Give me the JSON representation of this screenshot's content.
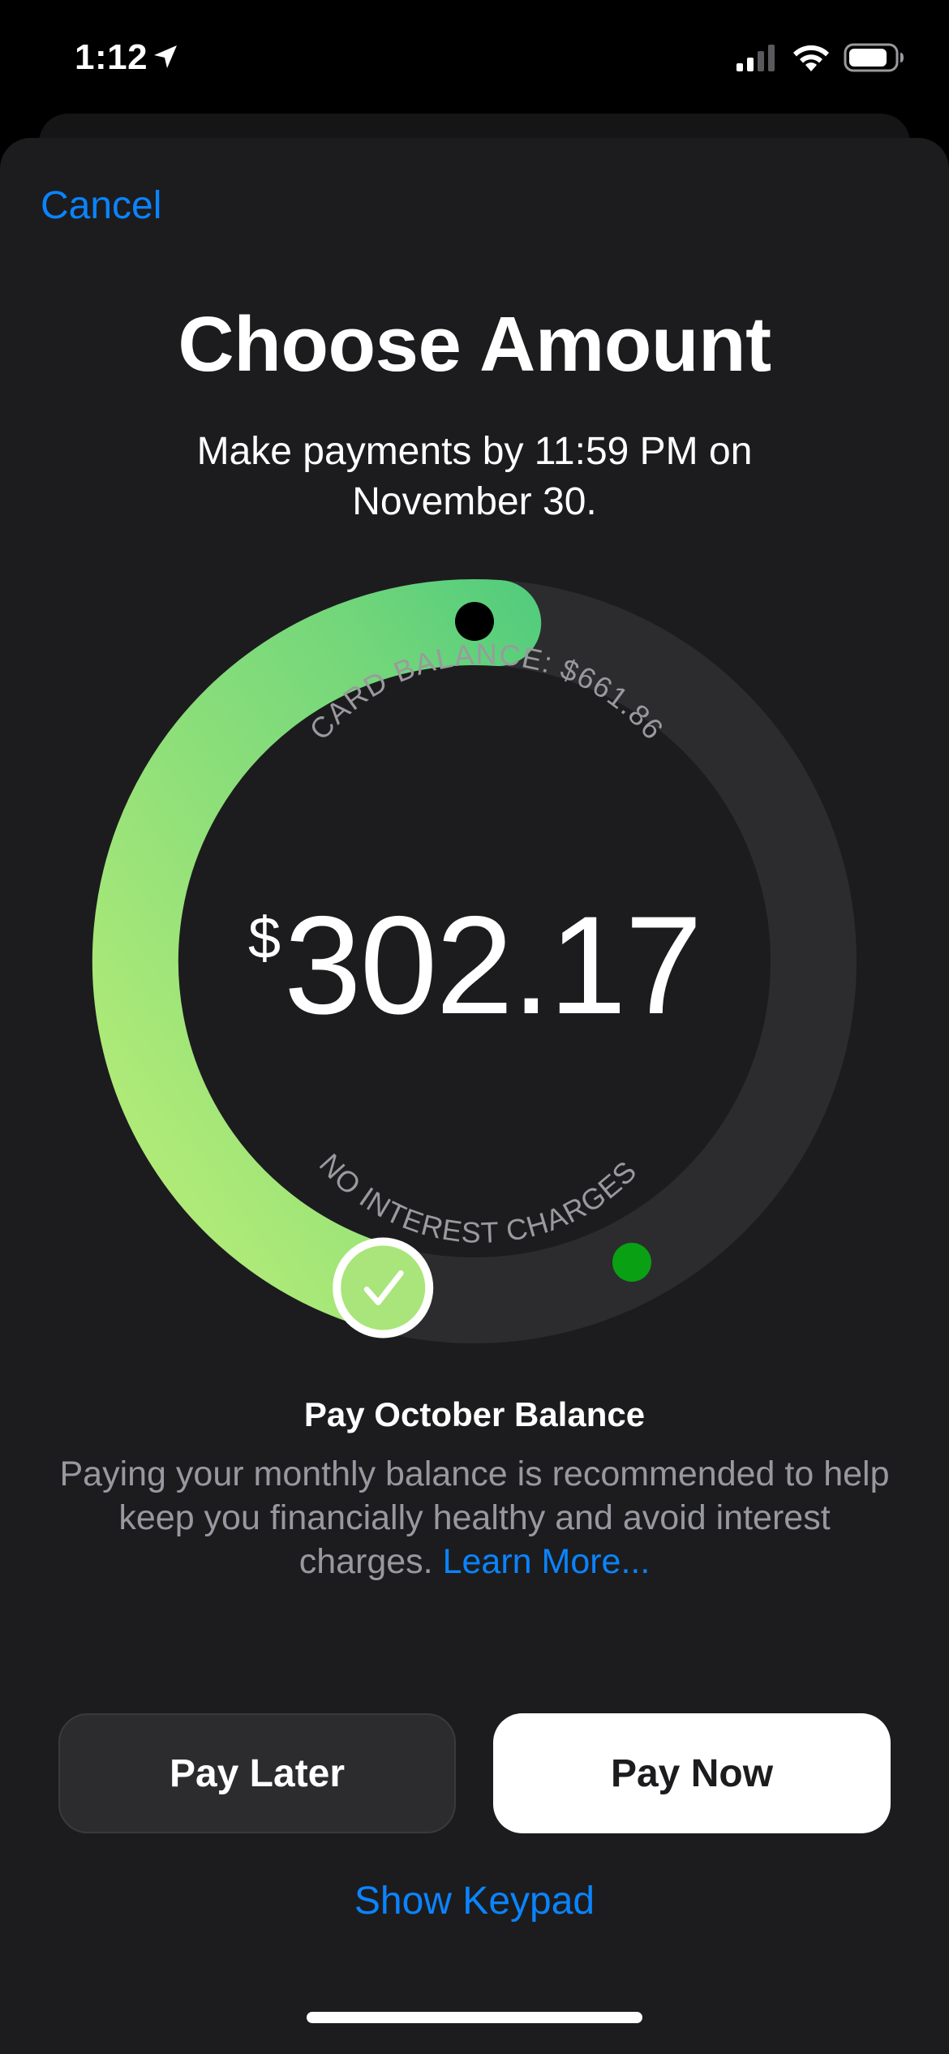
{
  "status_bar": {
    "time": "1:12",
    "icons": [
      "location-arrow-icon",
      "cellular-signal-icon",
      "wifi-icon",
      "battery-icon"
    ]
  },
  "header": {
    "cancel_label": "Cancel",
    "title": "Choose Amount",
    "subtitle": "Make payments by 11:59 PM on November 30."
  },
  "ring": {
    "top_label": "CARD BALANCE: $661.86",
    "bottom_label": "NO INTEREST CHARGES",
    "amount_currency": "$",
    "amount_value": "302.17",
    "selected_fraction_of_balance": 0.4565,
    "handle_icon": "checkmark-icon",
    "colors": {
      "track": "#2c2c2e",
      "gradient_start": "#b5ec78",
      "gradient_mid": "#7dd87a",
      "gradient_end": "#2cc07f",
      "endpoint_dot": "#000000",
      "marker_dot": "#0aa014"
    }
  },
  "option": {
    "title": "Pay October Balance",
    "description": "Paying your monthly balance is recommended to help keep you financially healthy and avoid interest charges.",
    "learn_more_label": "Learn More..."
  },
  "actions": {
    "pay_later_label": "Pay Later",
    "pay_now_label": "Pay Now",
    "show_keypad_label": "Show Keypad"
  },
  "colors": {
    "background": "#1c1c1e",
    "accent": "#0a84ff"
  }
}
